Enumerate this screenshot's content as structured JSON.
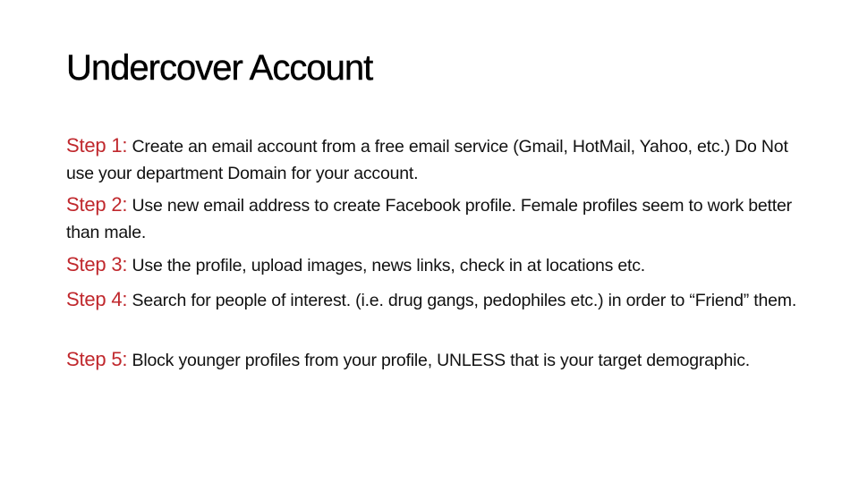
{
  "slide": {
    "title": "Undercover Account",
    "accent_color": "#c0282d",
    "steps": [
      {
        "label": "Step 1:",
        "text": " Create an email account from a free email service   (Gmail, HotMail, Yahoo, etc.) Do Not use your department Domain for your account."
      },
      {
        "label": "Step 2:",
        "text": " Use new email address to create Facebook profile.  Female profiles seem to work better than male."
      },
      {
        "label": "Step 3:",
        "text": " Use the profile, upload images, news links, check in at locations etc."
      },
      {
        "label": "Step 4:",
        "text": " Search for people of interest. (i.e. drug gangs, pedophiles etc.) in order to “Friend” them."
      },
      {
        "label": "Step 5:",
        "text": " Block younger profiles from your profile, UNLESS that is your target demographic."
      }
    ]
  }
}
